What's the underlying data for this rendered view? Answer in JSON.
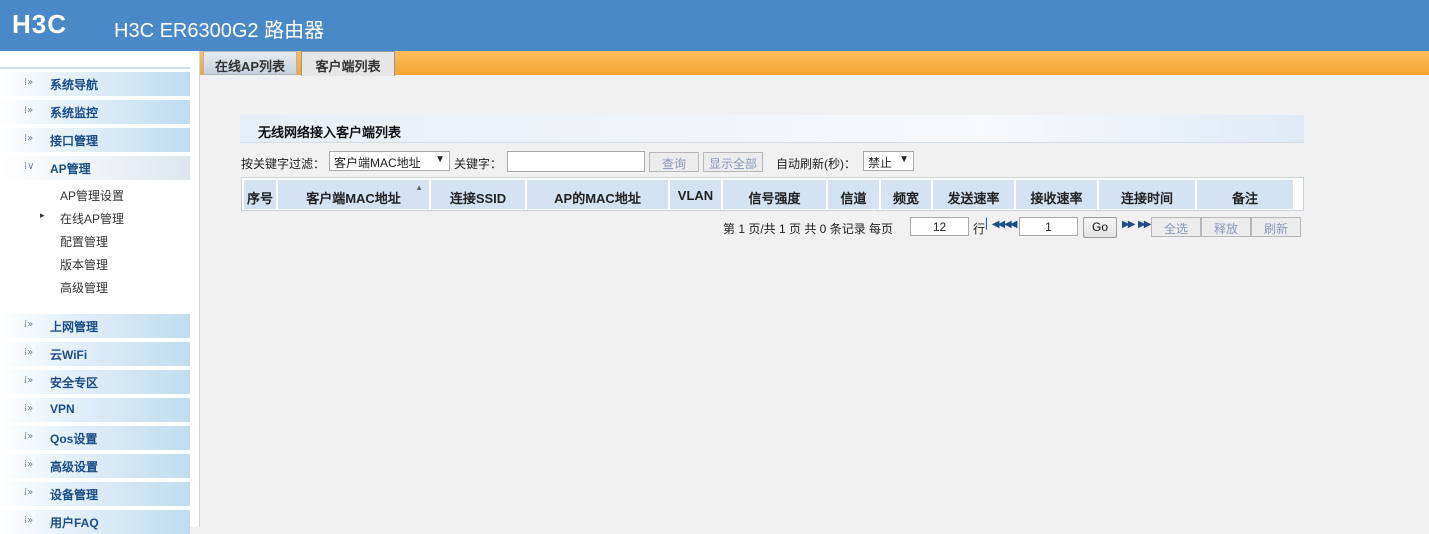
{
  "header": {
    "logo": "H3C",
    "product": "H3C ER6300G2 路由器"
  },
  "sidebar": {
    "menu_top": [
      {
        "label": "系统导航"
      },
      {
        "label": "系统监控"
      },
      {
        "label": "接口管理"
      },
      {
        "label": "AP管理"
      }
    ],
    "submenu": [
      {
        "label": "AP管理设置"
      },
      {
        "label": "在线AP管理"
      },
      {
        "label": "配置管理"
      },
      {
        "label": "版本管理"
      },
      {
        "label": "高级管理"
      }
    ],
    "menu_bottom": [
      {
        "label": "上网管理"
      },
      {
        "label": "云WiFi"
      },
      {
        "label": "安全专区"
      },
      {
        "label": "VPN"
      },
      {
        "label": "Qos设置"
      },
      {
        "label": "高级设置"
      },
      {
        "label": "设备管理"
      },
      {
        "label": "用户FAQ"
      }
    ]
  },
  "tabs": [
    {
      "label": "在线AP列表"
    },
    {
      "label": "客户端列表"
    }
  ],
  "panel": {
    "title": "无线网络接入客户端列表"
  },
  "filter": {
    "keyword_filter_label": "按关键字过滤：",
    "filter_select_value": "客户端MAC地址",
    "keyword_label": "关键字：",
    "keyword_value": "",
    "query_button": "查询",
    "show_all_button": "显示全部",
    "auto_refresh_label": "自动刷新(秒)：",
    "auto_refresh_value": "禁止"
  },
  "table": {
    "columns": [
      "序号",
      "客户端MAC地址",
      "连接SSID",
      "AP的MAC地址",
      "VLAN",
      "信号强度",
      "信道",
      "频宽",
      "发送速率",
      "接收速率",
      "连接时间",
      "备注"
    ],
    "rows": []
  },
  "pager": {
    "page_text": "第 1 页/共 1 页 共 0 条记录 每页",
    "per_page": "12",
    "rows_label": "行",
    "page_input": "1",
    "go_button": "Go",
    "select_all_button": "全选",
    "release_button": "释放",
    "refresh_button": "刷新"
  }
}
